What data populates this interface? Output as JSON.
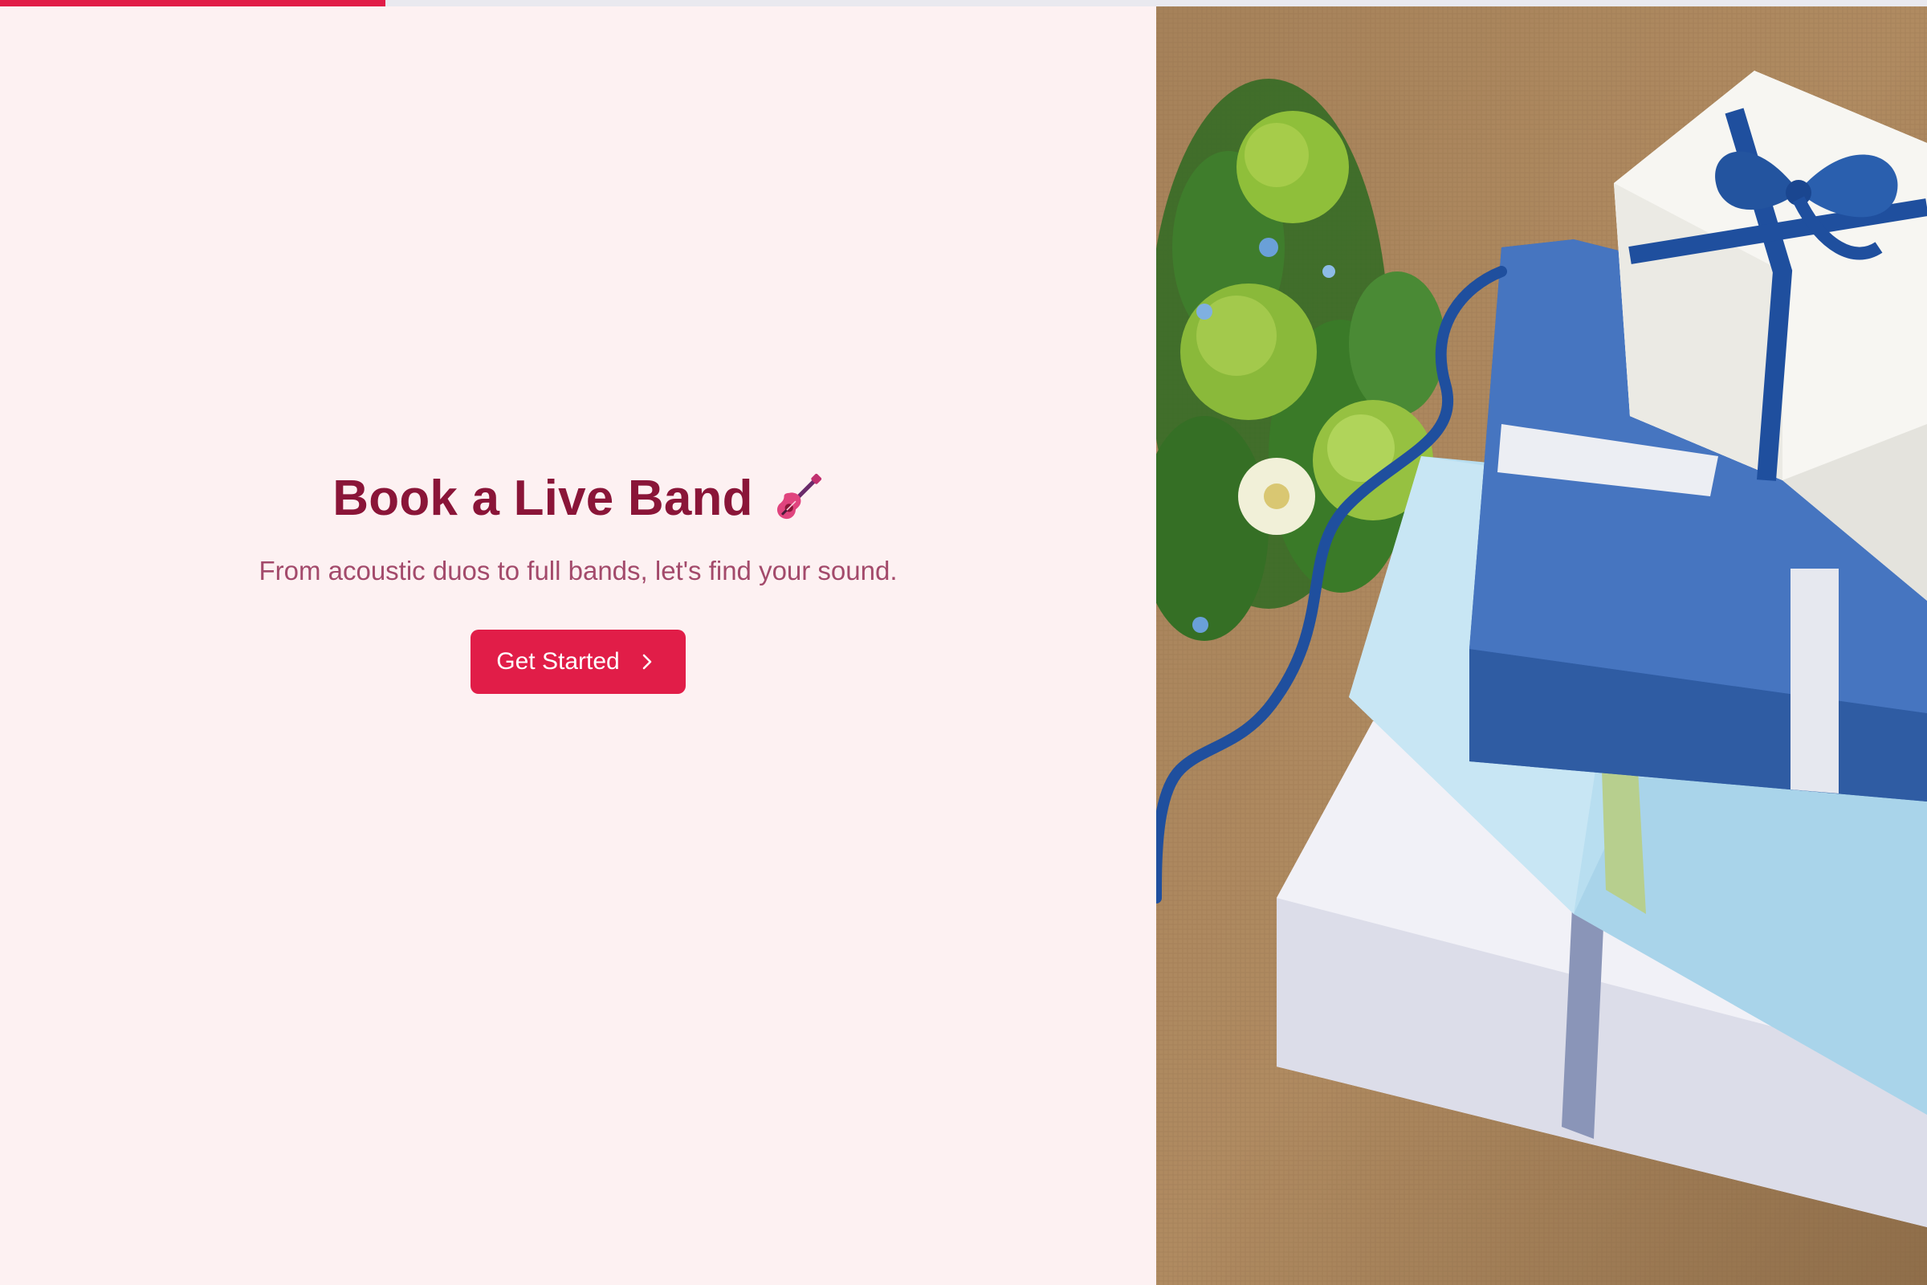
{
  "progress": {
    "value_percent": 20
  },
  "hero": {
    "title": "Book a Live Band",
    "title_icon": "guitar-icon",
    "subtitle": "From acoustic duos to full bands, let's find your sound.",
    "cta_label": "Get Started",
    "cta_icon": "chevron-right-icon"
  },
  "colors": {
    "accent": "#e11d48",
    "title": "#8a1538",
    "subtitle": "#a34a6b",
    "background": "#fdf1f2"
  }
}
